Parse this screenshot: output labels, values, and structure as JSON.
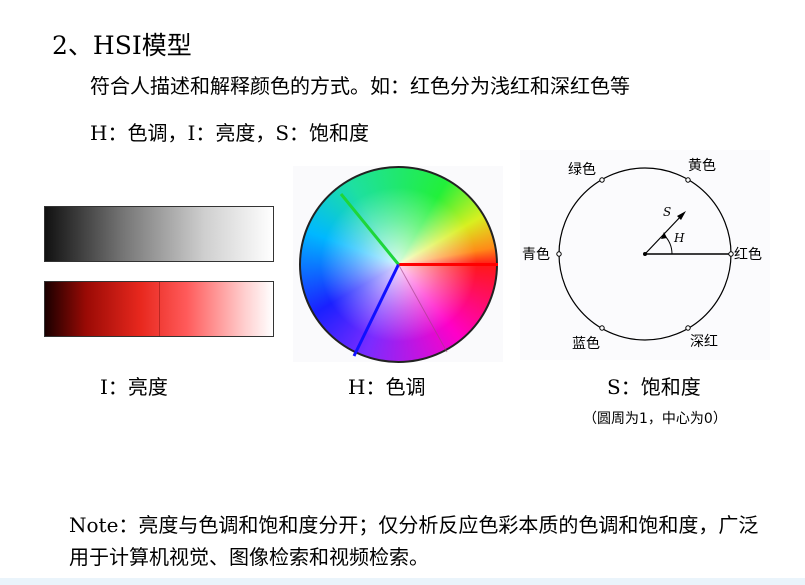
{
  "title": "2、HSI模型",
  "description": "符合人描述和解释颜色的方式。如：红色分为浅红和深红色等",
  "components": "H：色调，I：亮度，S：饱和度",
  "captions": {
    "intensity": "I：亮度",
    "hue": "H：色调",
    "saturation": "S：饱和度",
    "saturation_note": "（圆周为1，中心为0）"
  },
  "diagram": {
    "labels": {
      "green": "绿色",
      "yellow": "黄色",
      "cyan": "青色",
      "red": "红色",
      "blue": "蓝色",
      "deep_red": "深红"
    },
    "s_label": "S",
    "h_label": "H"
  },
  "note": "Note：亮度与色调和饱和度分开；仅分析反应色彩本质的色调和饱和度，广泛用于计算机视觉、图像检索和视频检索。"
}
